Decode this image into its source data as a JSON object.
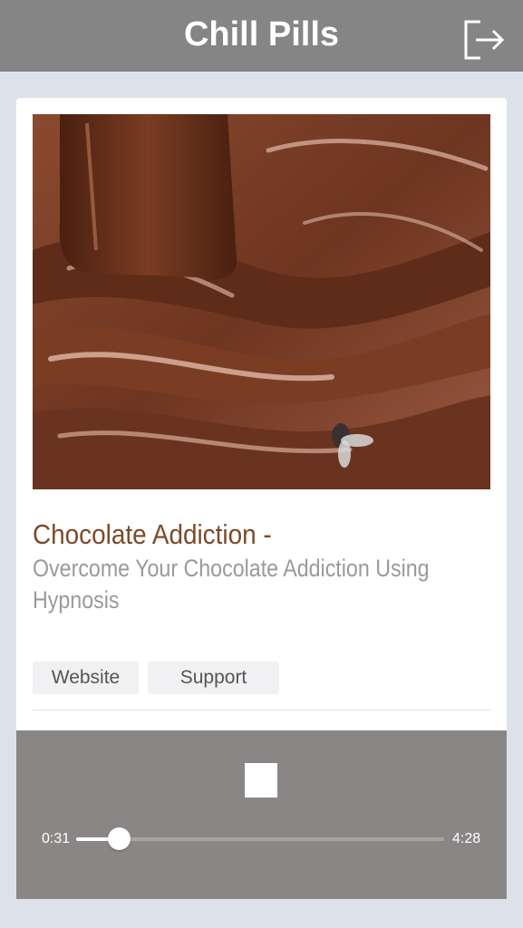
{
  "header": {
    "title": "Chill Pills",
    "logout_icon": "logout-icon"
  },
  "track": {
    "title": "Chocolate Addiction -",
    "subtitle": "Overcome Your Chocolate Addiction Using Hypnosis",
    "artwork_icon": "melted-chocolate-image"
  },
  "links": {
    "website_label": "Website",
    "support_label": "Support"
  },
  "player": {
    "current_time": "0:31",
    "total_time": "4:28",
    "progress": 0.1157,
    "stop_icon": "stop-icon"
  },
  "colors": {
    "header": "#858585",
    "background": "#dde2ea",
    "title": "#7b4a2a",
    "subtitle": "#9a9a9a",
    "player": "#8a8686"
  }
}
